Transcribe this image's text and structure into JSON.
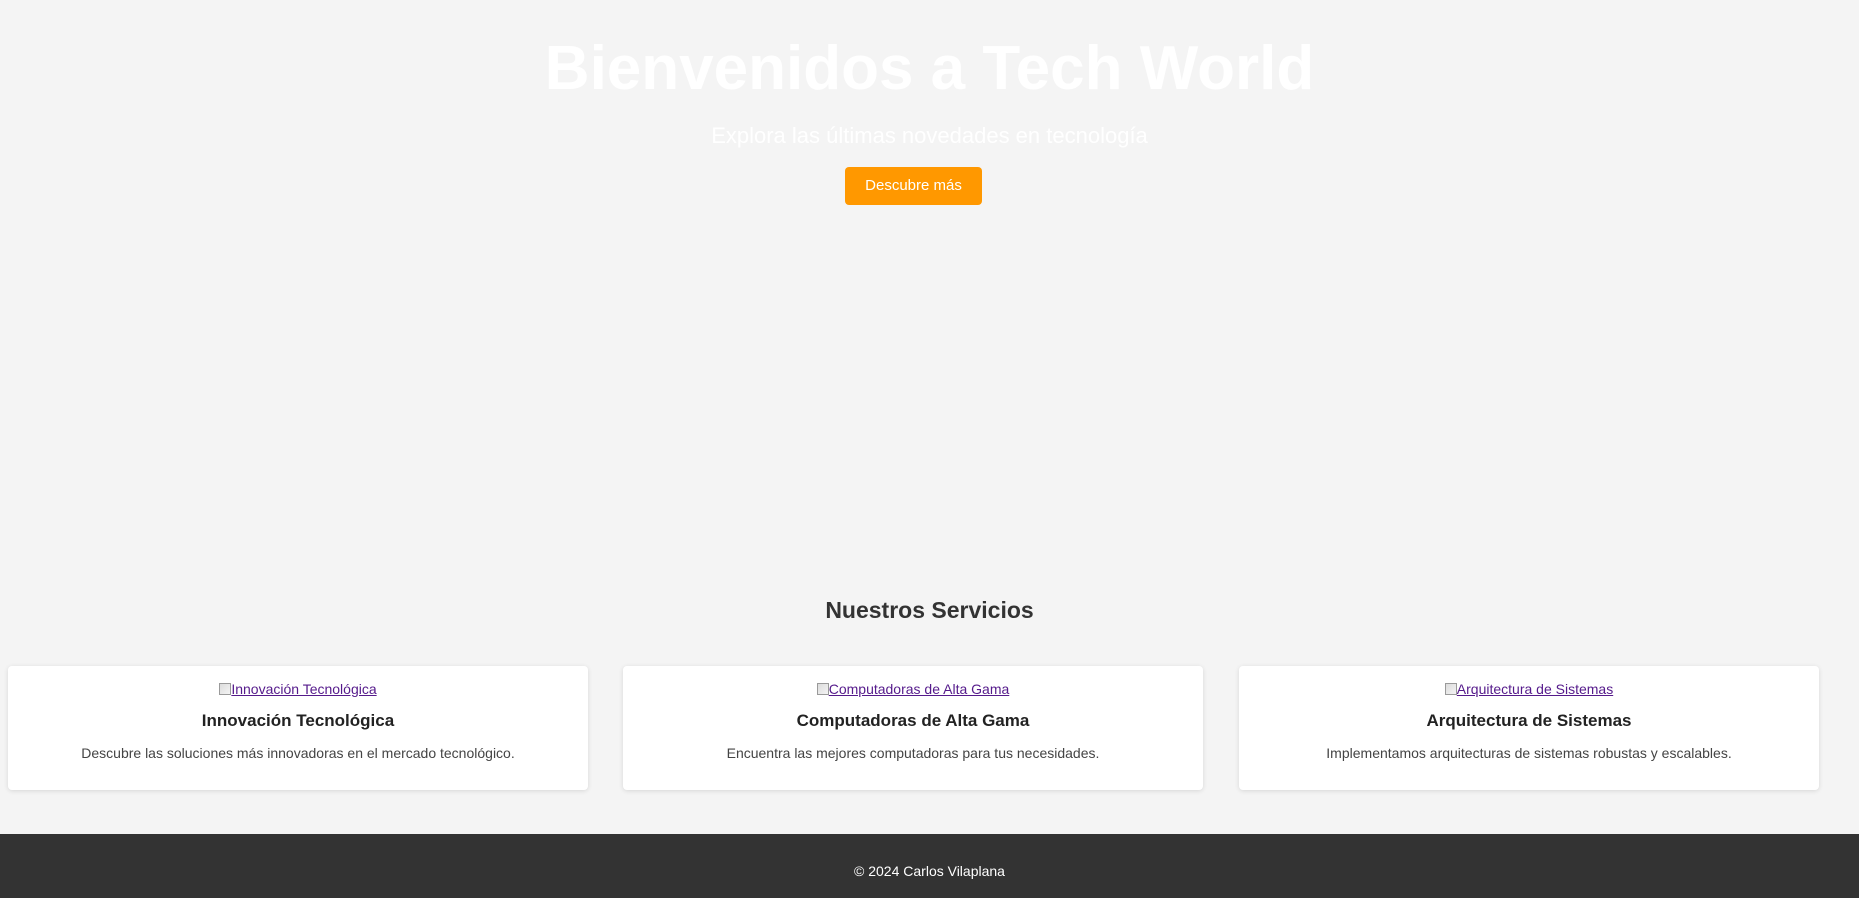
{
  "hero": {
    "title": "Bienvenidos a Tech World",
    "subtitle": "Explora las últimas novedades en tecnología",
    "button_label": "Descubre más"
  },
  "services": {
    "title": "Nuestros Servicios",
    "cards": [
      {
        "image_alt": "Innovación Tecnológica",
        "title": "Innovación Tecnológica",
        "description": "Descubre las soluciones más innovadoras en el mercado tecnológico."
      },
      {
        "image_alt": "Computadoras de Alta Gama",
        "title": "Computadoras de Alta Gama",
        "description": "Encuentra las mejores computadoras para tus necesidades."
      },
      {
        "image_alt": "Arquitectura de Sistemas",
        "title": "Arquitectura de Sistemas",
        "description": "Implementamos arquitecturas de sistemas robustas y escalables."
      }
    ]
  },
  "footer": {
    "text": "© 2024 Carlos Vilaplana"
  },
  "colors": {
    "background": "#f4f4f4",
    "accent": "#ff9800",
    "footer": "#333333",
    "link": "#551a8b"
  },
  "icons": {
    "broken_image": "broken-image-icon"
  }
}
